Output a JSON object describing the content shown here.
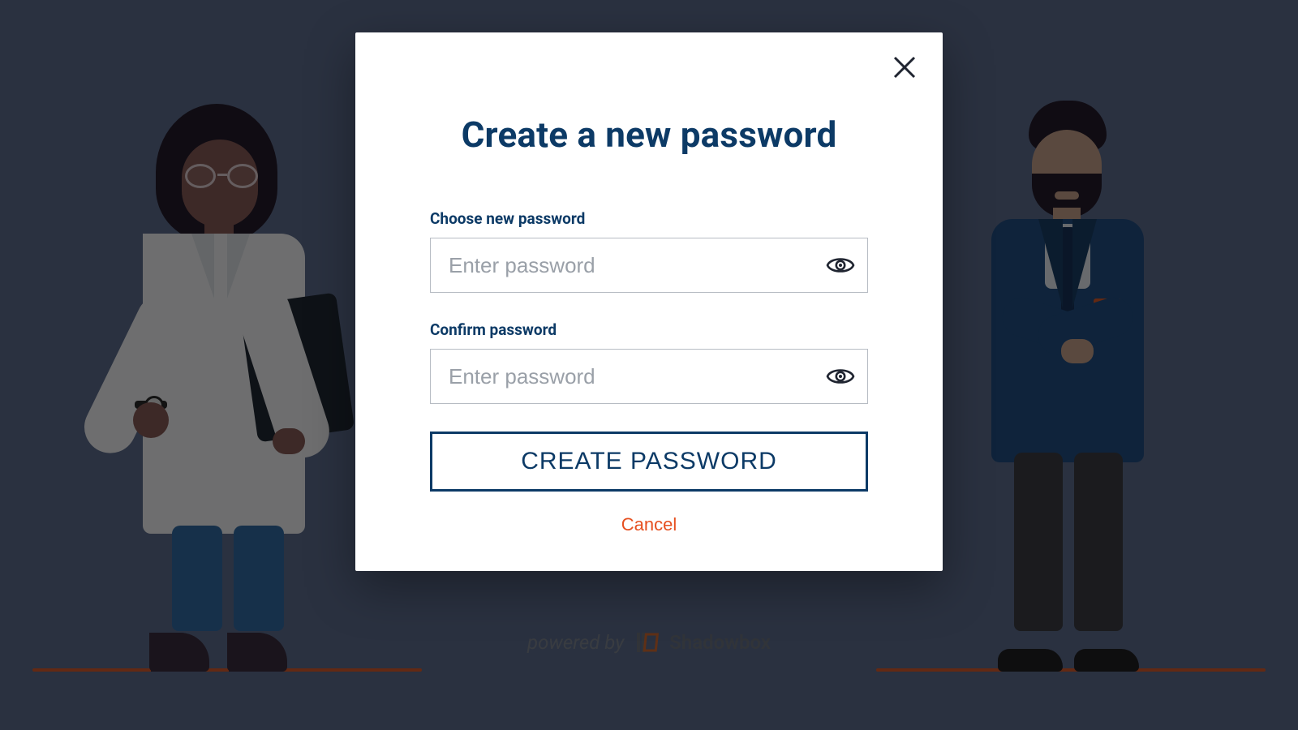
{
  "modal": {
    "title": "Create a new password",
    "choose_label": "Choose new password",
    "confirm_label": "Confirm password",
    "password_placeholder": "Enter password",
    "confirm_placeholder": "Enter password",
    "submit_label": "CREATE PASSWORD",
    "cancel_label": "Cancel"
  },
  "footer": {
    "powered_by": "powered by",
    "brand": "Shadowbox"
  },
  "colors": {
    "heading": "#0c3a66",
    "accent": "#e65020",
    "overlay_bg": "#2a3140"
  }
}
